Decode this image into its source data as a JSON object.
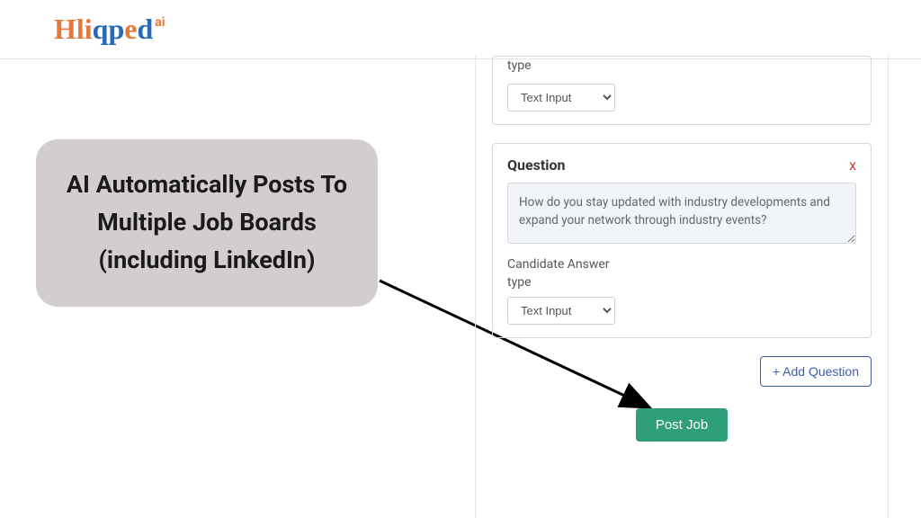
{
  "logo": {
    "text": "Hliqped",
    "superscript": "ai"
  },
  "callout": {
    "text": "AI Automatically Posts To Multiple Job Boards (including LinkedIn)"
  },
  "form": {
    "partial_card": {
      "answer_type_label": "type",
      "type_options": [
        "Text Input"
      ],
      "selected_type": "Text Input"
    },
    "question_card": {
      "title": "Question",
      "remove_label": "x",
      "question_text": "How do you stay updated with industry developments and expand your network through industry events?",
      "answer_label_line1": "Candidate Answer",
      "answer_label_line2": "type",
      "type_options": [
        "Text Input"
      ],
      "selected_type": "Text Input"
    },
    "add_question_label": "+ Add Question",
    "post_job_label": "Post Job"
  }
}
